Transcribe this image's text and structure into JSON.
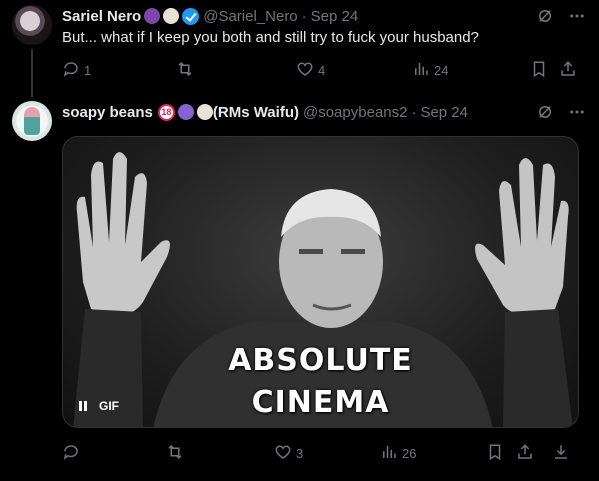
{
  "tweet1": {
    "display_name": "Sariel Nero",
    "handle": "@Sariel_Nero",
    "separator": "·",
    "date": "Sep 24",
    "text": "But... what if I keep you both and still try to fuck your husband?",
    "counts": {
      "replies": "1",
      "reposts": "",
      "likes": "4",
      "views": "24"
    }
  },
  "tweet2": {
    "display_name": "soapy beans",
    "badge": "18",
    "name_suffix": "(RMs Waifu)",
    "handle": "@soapybeans2",
    "separator": "·",
    "date": "Sep 24",
    "media": {
      "caption_line1": "ABSOLUTE",
      "caption_line2": "CINEMA",
      "gif_label": "GIF"
    },
    "counts": {
      "replies": "",
      "reposts": "",
      "likes": "3",
      "views": "26"
    }
  },
  "icons": {
    "more": "more-icon",
    "grok": "grok-icon",
    "reply": "reply-icon",
    "repost": "repost-icon",
    "like": "like-icon",
    "views": "views-icon",
    "bookmark": "bookmark-icon",
    "share": "share-icon",
    "download": "download-icon"
  },
  "colors": {
    "background": "#000000",
    "text": "#e7e9ea",
    "muted": "#71767b",
    "verified": "#1d9bf0"
  }
}
